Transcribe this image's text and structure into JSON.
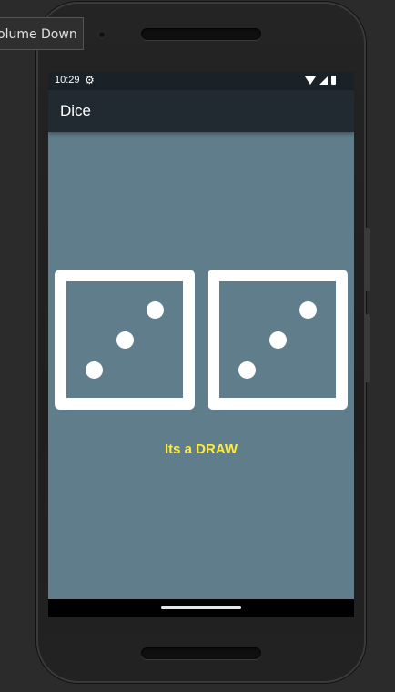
{
  "tooltip": {
    "text": "olume Down"
  },
  "status_bar": {
    "time": "10:29",
    "settings_icon": "gear-icon",
    "icons": [
      "wifi-icon",
      "signal-icon",
      "battery-icon"
    ]
  },
  "app_bar": {
    "title": "Dice"
  },
  "dice": [
    {
      "value": 3
    },
    {
      "value": 3
    }
  ],
  "result": {
    "text": "Its a DRAW"
  },
  "colors": {
    "screen_background": "#607d8b",
    "app_bar": "#212a31",
    "result_text": "#ffeb3b",
    "die": "#ffffff"
  }
}
